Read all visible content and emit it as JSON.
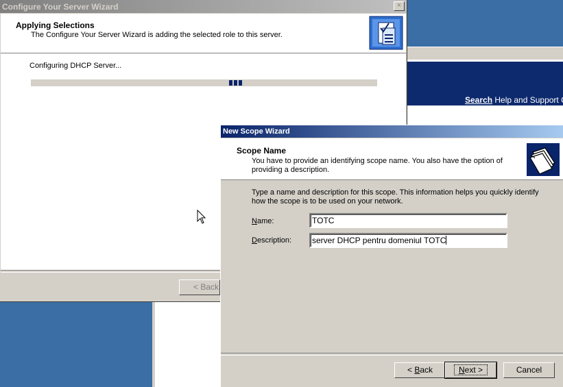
{
  "help_window": {
    "search_bold": "Search",
    "search_rest": " Help and Support Ce"
  },
  "configure_wizard": {
    "title": "Configure Your Server Wizard",
    "close_label": "×",
    "heading": "Applying Selections",
    "subheading": "The Configure Your Server Wizard is adding the selected role to this server.",
    "status": "Configuring DHCP Server...",
    "back_label": "< Back",
    "icon": "server-wizard-icon"
  },
  "scope_wizard": {
    "title": "New Scope Wizard",
    "heading": "Scope Name",
    "subheading": "You have to provide an identifying scope name. You also have the option of providing a description.",
    "intro": "Type a name and description for this scope. This information helps you quickly identify how the scope is to be used on your network.",
    "name_label_underlined": "N",
    "name_label_rest": "ame:",
    "name_value": "TOTC",
    "description_label_underlined": "D",
    "description_label_rest": "escription:",
    "description_value": "server DHCP pentru domeniul TOTC",
    "back_pre": "< ",
    "back_underlined": "B",
    "back_rest": "ack",
    "next_underlined": "N",
    "next_rest": "ext >",
    "cancel_label": "Cancel",
    "icon": "folders-icon"
  }
}
